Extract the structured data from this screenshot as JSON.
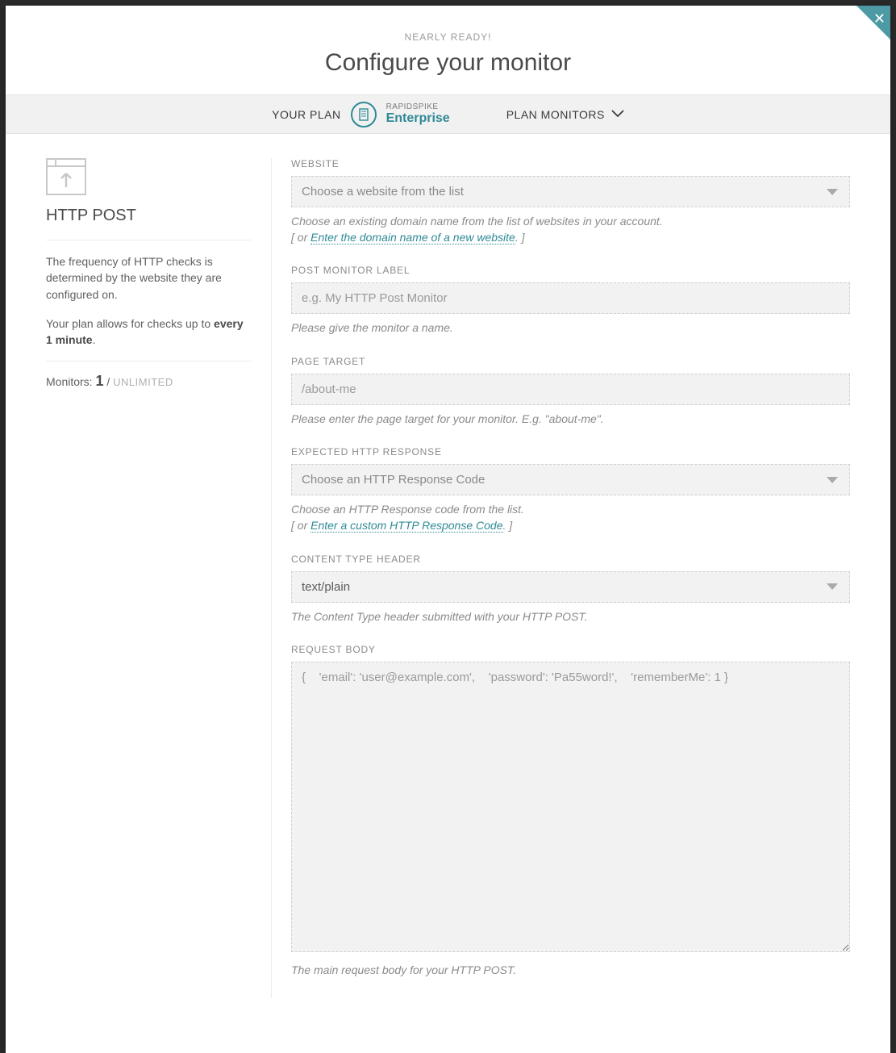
{
  "header": {
    "eyebrow": "NEARLY READY!",
    "title": "Configure your monitor"
  },
  "planBar": {
    "yourPlanLabel": "YOUR PLAN",
    "brandTop": "RAPIDSPIKE",
    "brandBottom": "Enterprise",
    "planMonitorsLabel": "PLAN MONITORS"
  },
  "sidebar": {
    "title": "HTTP POST",
    "desc1a": "The frequency of HTTP checks is determined by the website they are configured on.",
    "desc2a": "Your plan allows for checks up to ",
    "desc2b": "every 1 minute",
    "desc2c": ".",
    "monitorsLabel": "Monitors:",
    "monitorsCount": "1",
    "monitorsSep": " / ",
    "monitorsLimit": "UNLIMITED"
  },
  "fields": {
    "website": {
      "label": "WEBSITE",
      "placeholder": "Choose a website from the list",
      "hint1": "Choose an existing domain name from the list of websites in your account.",
      "orOpen": "[ or ",
      "link": "Enter the domain name of a new website",
      "orClose": ". ]"
    },
    "postLabel": {
      "label": "POST MONITOR LABEL",
      "placeholder": "e.g. My HTTP Post Monitor",
      "hint": "Please give the monitor a name."
    },
    "pageTarget": {
      "label": "PAGE TARGET",
      "placeholder": "/about-me",
      "hint": "Please enter the page target for your monitor. E.g. \"about-me\"."
    },
    "expectedResponse": {
      "label": "EXPECTED HTTP RESPONSE",
      "placeholder": "Choose an HTTP Response Code",
      "hint1": "Choose an HTTP Response code from the list.",
      "orOpen": "[ or ",
      "link": "Enter a custom HTTP Response Code",
      "orClose": ". ]"
    },
    "contentType": {
      "label": "CONTENT TYPE HEADER",
      "value": "text/plain",
      "hint": "The Content Type header submitted with your HTTP POST."
    },
    "requestBody": {
      "label": "REQUEST BODY",
      "placeholder": "{    'email': 'user@example.com',    'password': 'Pa55word!',    'rememberMe': 1 }",
      "hint": "The main request body for your HTTP POST."
    }
  }
}
